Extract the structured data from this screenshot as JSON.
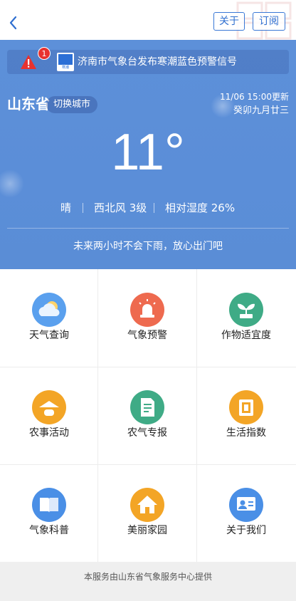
{
  "header": {
    "about_label": "关于",
    "subscribe_label": "订阅"
  },
  "alert": {
    "badge_count": "1",
    "text": "济南市气象台发布寒潮蓝色预警信号",
    "signal_label": "寒潮"
  },
  "location": {
    "province": "山东省",
    "switch_label": "切换城市",
    "update_time": "11/06 15:00更新",
    "lunar_date": "癸卯九月廿三"
  },
  "weather": {
    "temperature": "11°",
    "condition": "晴",
    "wind": "西北风 3级",
    "humidity": "相对湿度 26%",
    "forecast": "未来两小时不会下雨，放心出门吧"
  },
  "menu": [
    {
      "label": "天气查询",
      "icon": "weather-cloud-icon",
      "color": "#5aa0ee"
    },
    {
      "label": "气象预警",
      "icon": "alarm-siren-icon",
      "color": "#ee6a4f"
    },
    {
      "label": "作物适宜度",
      "icon": "sprout-icon",
      "color": "#3fab86"
    },
    {
      "label": "农事活动",
      "icon": "farmer-hat-icon",
      "color": "#f3a526"
    },
    {
      "label": "农气专报",
      "icon": "report-document-icon",
      "color": "#3fab86"
    },
    {
      "label": "生活指数",
      "icon": "index-book-icon",
      "color": "#f3a526"
    },
    {
      "label": "气象科普",
      "icon": "science-book-icon",
      "color": "#4a8fe6"
    },
    {
      "label": "美丽家园",
      "icon": "home-icon",
      "color": "#f3a526"
    },
    {
      "label": "关于我们",
      "icon": "about-card-icon",
      "color": "#4a8fe6"
    }
  ],
  "footer": {
    "text": "本服务由山东省气象服务中心提供"
  }
}
